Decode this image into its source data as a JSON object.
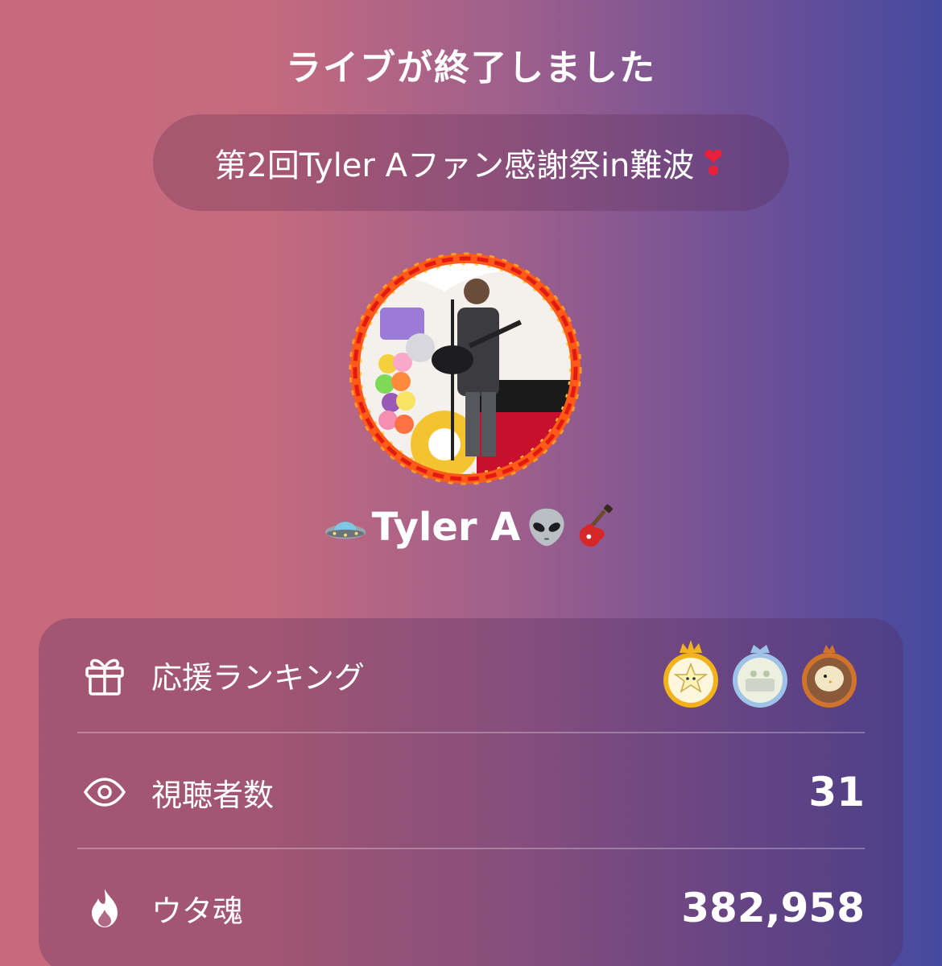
{
  "header": {
    "live_ended_title": "ライブが終了しました"
  },
  "stream": {
    "title": "第2回Tyler Aファン感謝祭in難波",
    "title_emoji": "❣"
  },
  "streamer": {
    "name": "Tyler A",
    "prefix_icon": "ufo-icon",
    "suffix_icons": [
      "alien-icon",
      "guitar-icon"
    ]
  },
  "stats": {
    "ranking_label": "応援ランキング",
    "viewers_label": "視聴者数",
    "viewers_value": "31",
    "uta_spirit_label": "ウタ魂",
    "uta_spirit_value": "382,958",
    "ranking_medals": [
      "gold",
      "silver",
      "bronze"
    ]
  },
  "colors": {
    "gold": "#f2b21c",
    "silver": "#9fc3e8",
    "bronze": "#d0732c",
    "heart": "#e8203a"
  }
}
